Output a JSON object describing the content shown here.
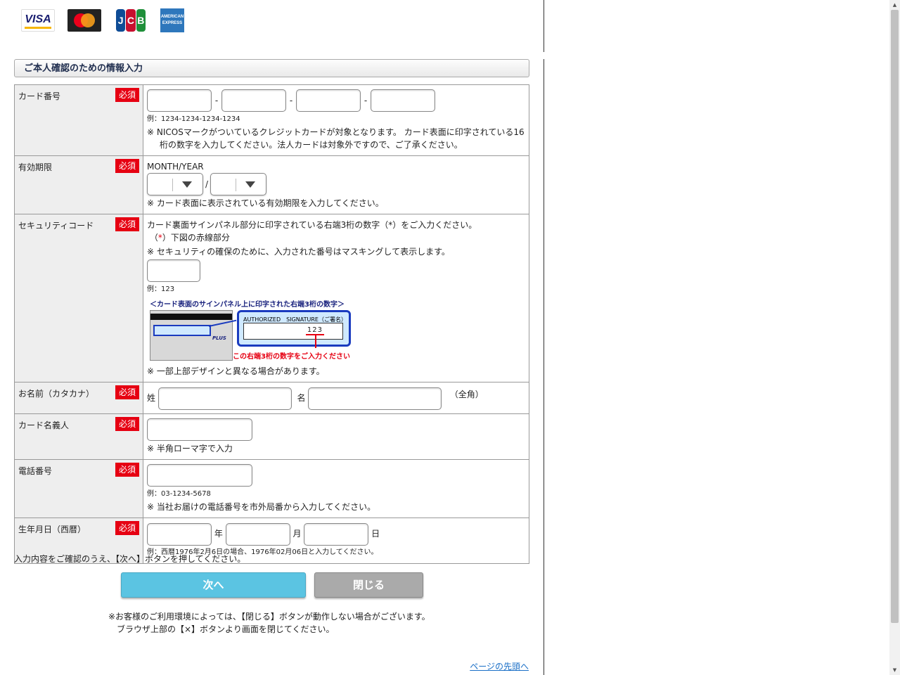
{
  "brands": [
    "VISA",
    "Mastercard",
    "JCB",
    "AMERICAN EXPRESS"
  ],
  "brand_labels": {
    "visa": "VISA",
    "jcb_j": "J",
    "jcb_c": "C",
    "jcb_b": "B",
    "amex": "AMERICAN EXPRESS"
  },
  "section_title": "ご本人確認のための情報入力",
  "required_label": "必須",
  "card_number": {
    "label": "カード番号",
    "separator": "-",
    "example": "例：1234-1234-1234-1234",
    "note": "※ NICOSマークがついているクレジットカードが対象となります。 カード表面に印字されている16桁の数字を入力してください。法人カードは対象外ですので、ご了承ください。"
  },
  "expiry": {
    "label": "有効期限",
    "format": "MONTH/YEAR",
    "separator": "/",
    "note": "※ カード表面に表示されている有効期限を入力してください。"
  },
  "security_code": {
    "label": "セキュリティコード",
    "line1": "カード裏面サインパネル部分に印字されている右端3桁の数字（*）をご入力ください。",
    "line2_pre": "（",
    "line2_star": "*",
    "line2_post": "）下図の赤線部分",
    "line3": "※ セキュリティの確保のために、入力された番号はマスキングして表示します。",
    "example": "例：123",
    "image_caption": "＜カード表面のサインパネル上に印字された右端3桁の数字＞",
    "image_signature": "AUTHORIZED　SIGNATURE（ご署名）",
    "image_code": "123",
    "image_card_brand": "PLUS",
    "image_red_caption": "この右端3桁の数字をご入力ください",
    "note": "※ 一部上部デザインと異なる場合があります。"
  },
  "name_kana": {
    "label": "お名前（カタカナ）",
    "sei": "姓",
    "mei": "名",
    "suffix": "（全角）"
  },
  "card_holder": {
    "label": "カード名義人",
    "note": "※ 半角ローマ字で入力"
  },
  "phone": {
    "label": "電話番号",
    "example": "例：03-1234-5678",
    "note": "※ 当社お届けの電話番号を市外局番から入力してください。"
  },
  "birthday": {
    "label": "生年月日（西暦）",
    "year": "年",
    "month": "月",
    "day": "日",
    "example": "例：西暦1976年2月6日の場合、1976年02月06日と入力してください。"
  },
  "instruction": "入力内容をご確認のうえ、【次へ】ボタンを押してください。",
  "next_button": "次へ",
  "close_button": "閉じる",
  "footnote1": "※お客様のご利用環境によっては、【閉じる】ボタンが動作しない場合がございます。",
  "footnote2": "ブラウザ上部の【×】ボタンより画面を閉じてください。",
  "top_link": "ページの先頭へ"
}
